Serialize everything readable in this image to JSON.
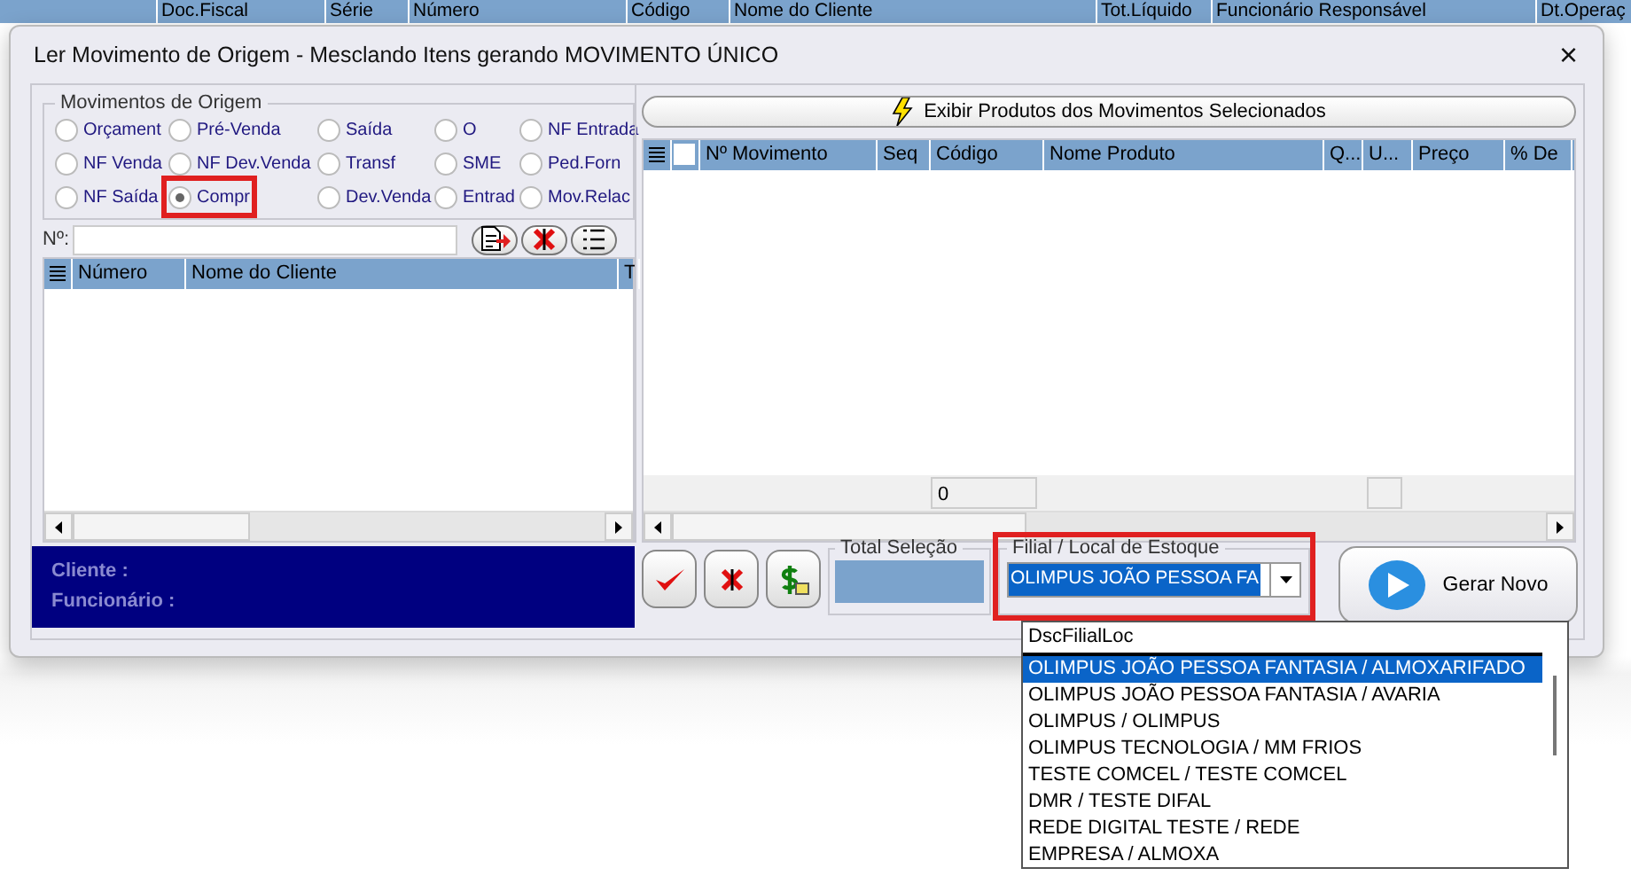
{
  "background_grid": {
    "columns": [
      "Doc.Fiscal",
      "Série",
      "Número",
      "Código",
      "Nome do Cliente",
      "Tot.Líquido",
      "Funcionário Responsável",
      "Dt.Operaç"
    ]
  },
  "window": {
    "title": "Ler Movimento de Origem - Mesclando Itens gerando MOVIMENTO ÚNICO",
    "close": "×"
  },
  "origin_group": {
    "title": "Movimentos de Origem",
    "options": [
      {
        "label": "Orçament",
        "selected": false,
        "highlighted": false
      },
      {
        "label": "Pré-Venda",
        "selected": false,
        "highlighted": false
      },
      {
        "label": "Saída",
        "selected": false,
        "highlighted": false
      },
      {
        "label": "O",
        "selected": false,
        "highlighted": false
      },
      {
        "label": "NF Entrada",
        "selected": false,
        "highlighted": false
      },
      {
        "label": "NF Venda",
        "selected": false,
        "highlighted": false
      },
      {
        "label": "NF Dev.Venda",
        "selected": false,
        "highlighted": false
      },
      {
        "label": "Transf",
        "selected": false,
        "highlighted": false
      },
      {
        "label": "SME",
        "selected": false,
        "highlighted": false
      },
      {
        "label": "Ped.Forn",
        "selected": false,
        "highlighted": false
      },
      {
        "label": "NF Saída",
        "selected": false,
        "highlighted": false
      },
      {
        "label": "Compr",
        "selected": true,
        "highlighted": true
      },
      {
        "label": "Dev.Venda",
        "selected": false,
        "highlighted": false
      },
      {
        "label": "Entrad",
        "selected": false,
        "highlighted": false
      },
      {
        "label": "Mov.Relac",
        "selected": false,
        "highlighted": false
      }
    ]
  },
  "number_field": {
    "label": "Nº:"
  },
  "movements_table": {
    "columns": [
      "Número",
      "Nome do Cliente",
      "T"
    ]
  },
  "info_panel": {
    "lines": [
      "Cliente :",
      "Funcionário :"
    ]
  },
  "show_products_button": "Exibir Produtos dos Movimentos Selecionados",
  "products_table": {
    "select_all_checked": false,
    "columns": [
      "Nº Movimento",
      "Seq",
      "Código",
      "Nome Produto",
      "Q...",
      "U...",
      "Preço",
      "% De"
    ],
    "footer_count": "0"
  },
  "total_selection": {
    "title": "Total Seleção"
  },
  "branch": {
    "title": "Filial / Local de Estoque",
    "value": "OLIMPUS JOÃO PESSOA FA",
    "highlighted": true
  },
  "generate_button": "Gerar Novo",
  "branch_dropdown": {
    "header": "DscFilialLoc",
    "items": [
      {
        "label": "OLIMPUS JOÃO PESSOA FANTASIA  /  ALMOXARIFADO",
        "selected": true
      },
      {
        "label": "OLIMPUS JOÃO PESSOA FANTASIA  /  AVARIA",
        "selected": false
      },
      {
        "label": "OLIMPUS  /  OLIMPUS",
        "selected": false
      },
      {
        "label": "OLIMPUS TECNOLOGIA  /  MM FRIOS",
        "selected": false
      },
      {
        "label": "TESTE COMCEL  /  TESTE COMCEL",
        "selected": false
      },
      {
        "label": "DMR  /  TESTE DIFAL",
        "selected": false
      },
      {
        "label": "REDE DIGITAL TESTE  /  REDE",
        "selected": false
      },
      {
        "label": "EMPRESA  /  ALMOXA",
        "selected": false
      }
    ]
  }
}
